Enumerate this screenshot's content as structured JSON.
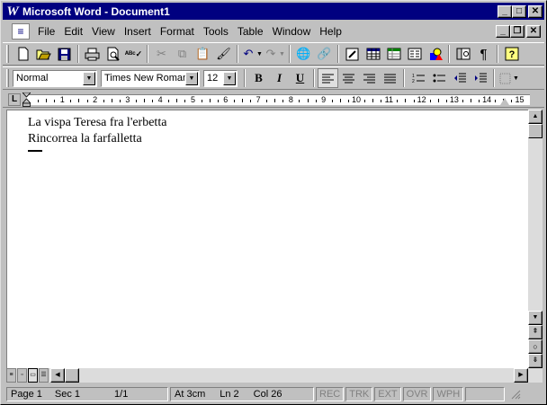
{
  "window": {
    "title": "Microsoft Word - Document1",
    "app_glyph": "W"
  },
  "titlebar_buttons": {
    "minimize": "_",
    "maximize": "□",
    "close": "✕"
  },
  "menubar": {
    "items": [
      "File",
      "Edit",
      "View",
      "Insert",
      "Format",
      "Tools",
      "Table",
      "Window",
      "Help"
    ],
    "mdi_buttons": {
      "minimize": "_",
      "restore": "❐",
      "close": "✕"
    }
  },
  "standard_toolbar": {
    "icons": [
      "new-icon",
      "open-icon",
      "save-icon",
      "print-icon",
      "print-preview-icon",
      "spelling-icon",
      "cut-icon",
      "copy-icon",
      "paste-icon",
      "format-painter-icon",
      "undo-icon",
      "redo-icon",
      "web-toolbar-icon",
      "hyperlink-icon",
      "tables-borders-icon",
      "insert-table-icon",
      "insert-excel-icon",
      "columns-icon",
      "drawing-icon",
      "document-map-icon",
      "show-hide-icon",
      "help-icon"
    ]
  },
  "formatting_toolbar": {
    "style": "Normal",
    "font": "Times New Roman",
    "size": "12",
    "bold": "B",
    "italic": "I",
    "underline": "U"
  },
  "ruler": {
    "numbers": [
      "1",
      "2",
      "3",
      "4",
      "5",
      "6",
      "7",
      "8",
      "9",
      "10",
      "11",
      "12",
      "13",
      "14",
      "15"
    ]
  },
  "document": {
    "lines": [
      "La vispa Teresa fra l'erbetta",
      "Rincorrea la farfalletta"
    ]
  },
  "statusbar": {
    "page": "Page  1",
    "sec": "Sec  1",
    "pages": "1/1",
    "at": "At  3cm",
    "ln": "Ln  2",
    "col": "Col  26",
    "rec": "REC",
    "trk": "TRK",
    "ext": "EXT",
    "ovr": "OVR",
    "wph": "WPH"
  }
}
